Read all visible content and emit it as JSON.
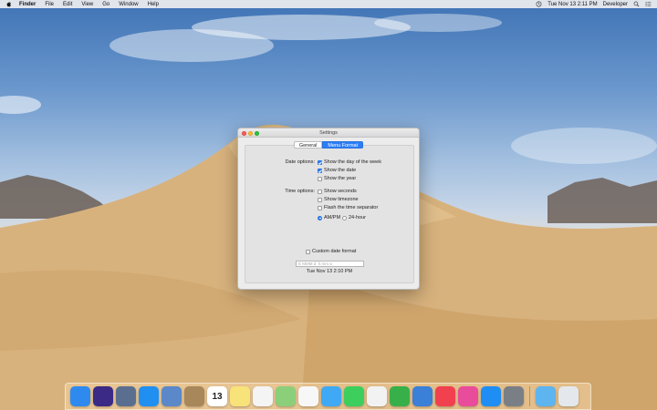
{
  "menubar": {
    "app_name": "Finder",
    "menus": [
      "File",
      "Edit",
      "View",
      "Go",
      "Window",
      "Help"
    ],
    "datetime": "Tue Nov 13  2:11 PM",
    "user": "Developer"
  },
  "window": {
    "title": "Settings",
    "tabs": [
      {
        "label": "General",
        "active": false
      },
      {
        "label": "Menu Format",
        "active": true
      }
    ],
    "date_options": {
      "label": "Date options:",
      "items": [
        {
          "label": "Show the day of the week",
          "checked": true
        },
        {
          "label": "Show the date",
          "checked": true
        },
        {
          "label": "Show the year",
          "checked": false
        }
      ]
    },
    "time_options": {
      "label": "Time options:",
      "items": [
        {
          "label": "Show seconds",
          "checked": false
        },
        {
          "label": "Show timezone",
          "checked": false
        },
        {
          "label": "Flash the time separator",
          "checked": false
        }
      ],
      "clock_modes": [
        {
          "label": "AM/PM",
          "selected": true
        },
        {
          "label": "24-hour",
          "selected": false
        }
      ]
    },
    "custom": {
      "label": "Custom date format",
      "checked": false,
      "placeholder": "E MMM d  h:mm a",
      "preview": "Tue Nov 13  2:10 PM"
    }
  },
  "dock": {
    "apps": [
      {
        "name": "finder-icon",
        "color": "#2f8af0"
      },
      {
        "name": "siri-icon",
        "color": "#3b2a86"
      },
      {
        "name": "launchpad-icon",
        "color": "#5a6f8f"
      },
      {
        "name": "safari-icon",
        "color": "#1f8ff2"
      },
      {
        "name": "mail-icon",
        "color": "#5a88c8"
      },
      {
        "name": "contacts-icon",
        "color": "#a8875a"
      },
      {
        "name": "calendar-icon",
        "color": "#ffffff",
        "text": "13"
      },
      {
        "name": "notes-icon",
        "color": "#f8e27a"
      },
      {
        "name": "reminders-icon",
        "color": "#f4f4f4"
      },
      {
        "name": "maps-icon",
        "color": "#8ccf7a"
      },
      {
        "name": "photos-icon",
        "color": "#f7f7f7"
      },
      {
        "name": "messages-icon",
        "color": "#3fa9f5"
      },
      {
        "name": "facetime-icon",
        "color": "#3ccf5e"
      },
      {
        "name": "pages-icon",
        "color": "#f2f2f2"
      },
      {
        "name": "numbers-icon",
        "color": "#38b04a"
      },
      {
        "name": "keynote-icon",
        "color": "#3a7fd8"
      },
      {
        "name": "news-icon",
        "color": "#f1404e"
      },
      {
        "name": "itunes-icon",
        "color": "#e94c9a"
      },
      {
        "name": "app-store-icon",
        "color": "#1e8ef4"
      },
      {
        "name": "system-preferences-icon",
        "color": "#7a7f86"
      },
      {
        "name": "downloads-folder-icon",
        "color": "#5eb4ef"
      },
      {
        "name": "trash-icon",
        "color": "#e4e8ec"
      }
    ]
  }
}
